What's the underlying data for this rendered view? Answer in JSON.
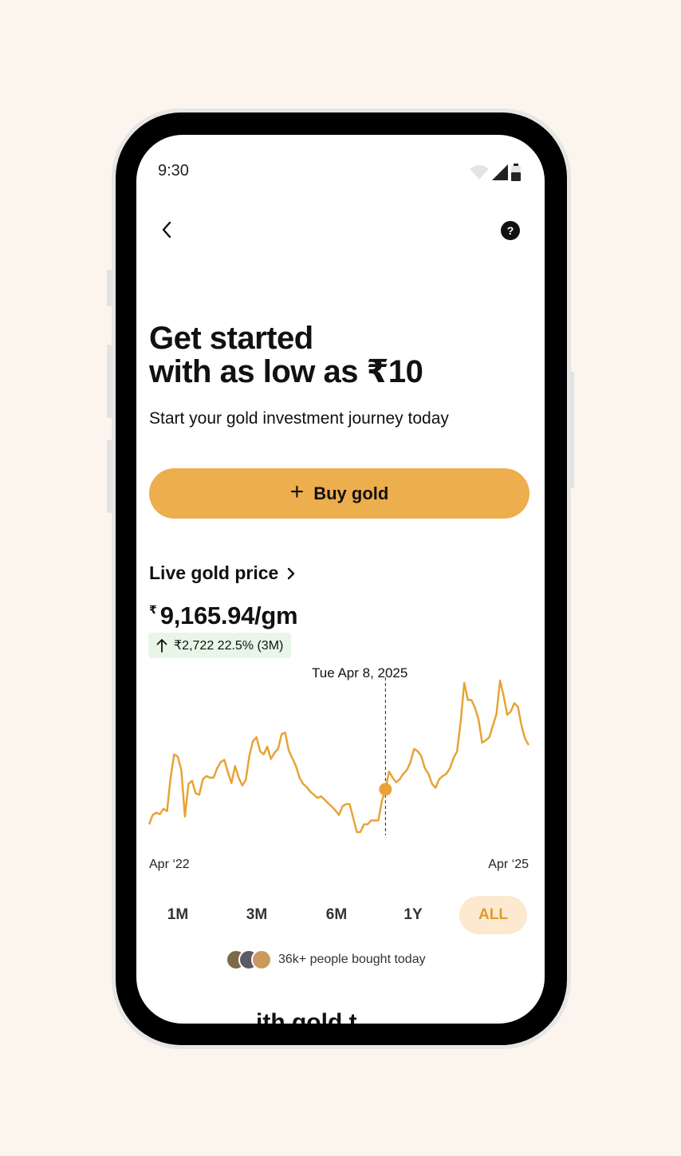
{
  "status": {
    "time": "9:30"
  },
  "hero": {
    "title_line1": "Get started",
    "title_line2": "with as low as ₹10",
    "subtitle": "Start your gold investment journey today"
  },
  "buy_button": {
    "icon": "plus-icon",
    "label": "Buy gold"
  },
  "live_price": {
    "title": "Live gold price",
    "currency_symbol": "₹",
    "price": "9,165.94/gm",
    "change": "₹2,722 22.5% (3M)",
    "change_color": "#e7f6e7"
  },
  "chart_data": {
    "type": "line",
    "x_start_label": "Apr ‘22",
    "x_end_label": "Apr ‘25",
    "highlight_label": "Tue Apr 8, 2025",
    "color": "#e8a336",
    "values": [
      10,
      22,
      25,
      23,
      30,
      27,
      70,
      100,
      97,
      80,
      20,
      62,
      66,
      50,
      48,
      68,
      72,
      70,
      70,
      82,
      90,
      93,
      77,
      63,
      85,
      70,
      60,
      67,
      98,
      117,
      122,
      104,
      100,
      110,
      94,
      102,
      107,
      126,
      128,
      105,
      95,
      85,
      70,
      62,
      58,
      52,
      48,
      44,
      46,
      42,
      37,
      33,
      28,
      22,
      33,
      36,
      36,
      18,
      0,
      0,
      10,
      10,
      15,
      15,
      15,
      40,
      55,
      78,
      70,
      64,
      68,
      75,
      80,
      90,
      107,
      104,
      98,
      82,
      75,
      62,
      57,
      68,
      72,
      75,
      82,
      95,
      104,
      142,
      192,
      170,
      170,
      160,
      145,
      115,
      118,
      122,
      137,
      152,
      195,
      175,
      151,
      155,
      166,
      161,
      137,
      120,
      112
    ],
    "highlight_index": 66
  },
  "ranges": [
    "1M",
    "3M",
    "6M",
    "1Y",
    "ALL"
  ],
  "active_range": "ALL",
  "social_proof": "36k+ people bought today",
  "next_section_peek": "ith gold t"
}
